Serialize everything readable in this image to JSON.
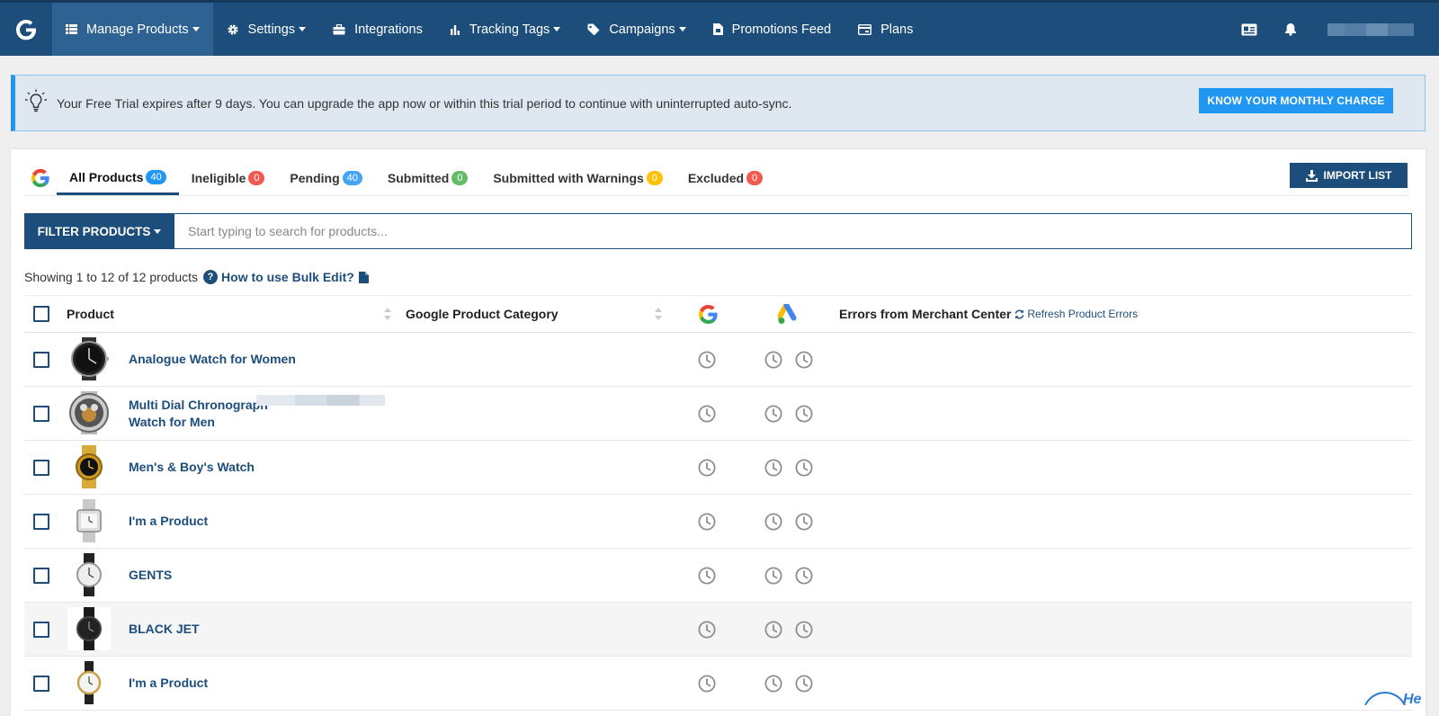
{
  "nav": {
    "items": [
      {
        "label": "Manage Products",
        "icon": "list-icon",
        "dropdown": true,
        "active": true
      },
      {
        "label": "Settings",
        "icon": "gear-icon",
        "dropdown": true
      },
      {
        "label": "Integrations",
        "icon": "briefcase-icon",
        "dropdown": false
      },
      {
        "label": "Tracking Tags",
        "icon": "bar-chart-icon",
        "dropdown": true
      },
      {
        "label": "Campaigns",
        "icon": "tag-icon",
        "dropdown": true
      },
      {
        "label": "Promotions Feed",
        "icon": "file-icon",
        "dropdown": false
      },
      {
        "label": "Plans",
        "icon": "card-icon",
        "dropdown": false
      }
    ]
  },
  "trial": {
    "message": "Your Free Trial expires after 9 days. You can upgrade the app now or within this trial period to continue with uninterrupted auto-sync.",
    "button": "KNOW YOUR MONTHLY CHARGE"
  },
  "tabs": [
    {
      "label": "All Products",
      "count": "40",
      "color": "#2196f3"
    },
    {
      "label": "Ineligible",
      "count": "0",
      "color": "#f05a4f"
    },
    {
      "label": "Pending",
      "count": "40",
      "color": "#42a5f5"
    },
    {
      "label": "Submitted",
      "count": "0",
      "color": "#66bb6a"
    },
    {
      "label": "Submitted with Warnings",
      "count": "0",
      "color": "#ffc107"
    },
    {
      "label": "Excluded",
      "count": "0",
      "color": "#f05a4f"
    }
  ],
  "import_button": "IMPORT LIST",
  "filter": {
    "button": "FILTER PRODUCTS",
    "placeholder": "Start typing to search for products..."
  },
  "summary": {
    "showing": "Showing 1 to 12 of 12 products",
    "help": "How to use Bulk Edit?"
  },
  "table": {
    "headers": {
      "product": "Product",
      "category": "Google Product Category",
      "errors": "Errors from Merchant Center",
      "refresh": "Refresh Product Errors"
    },
    "rows": [
      {
        "name": "Analogue Watch for Women",
        "watch": "black-round"
      },
      {
        "name": "Multi Dial Chronograph\nWatch for Men",
        "watch": "skeleton"
      },
      {
        "name": "Men's & Boy's Watch",
        "watch": "gold"
      },
      {
        "name": "I'm a Product",
        "watch": "silver-square"
      },
      {
        "name": "GENTS",
        "watch": "white-leather"
      },
      {
        "name": "BLACK JET",
        "watch": "black-jet"
      },
      {
        "name": "I'm a Product",
        "watch": "gold-white"
      }
    ]
  },
  "colors": {
    "primary": "#1d4e7b",
    "accent": "#2196f3"
  }
}
